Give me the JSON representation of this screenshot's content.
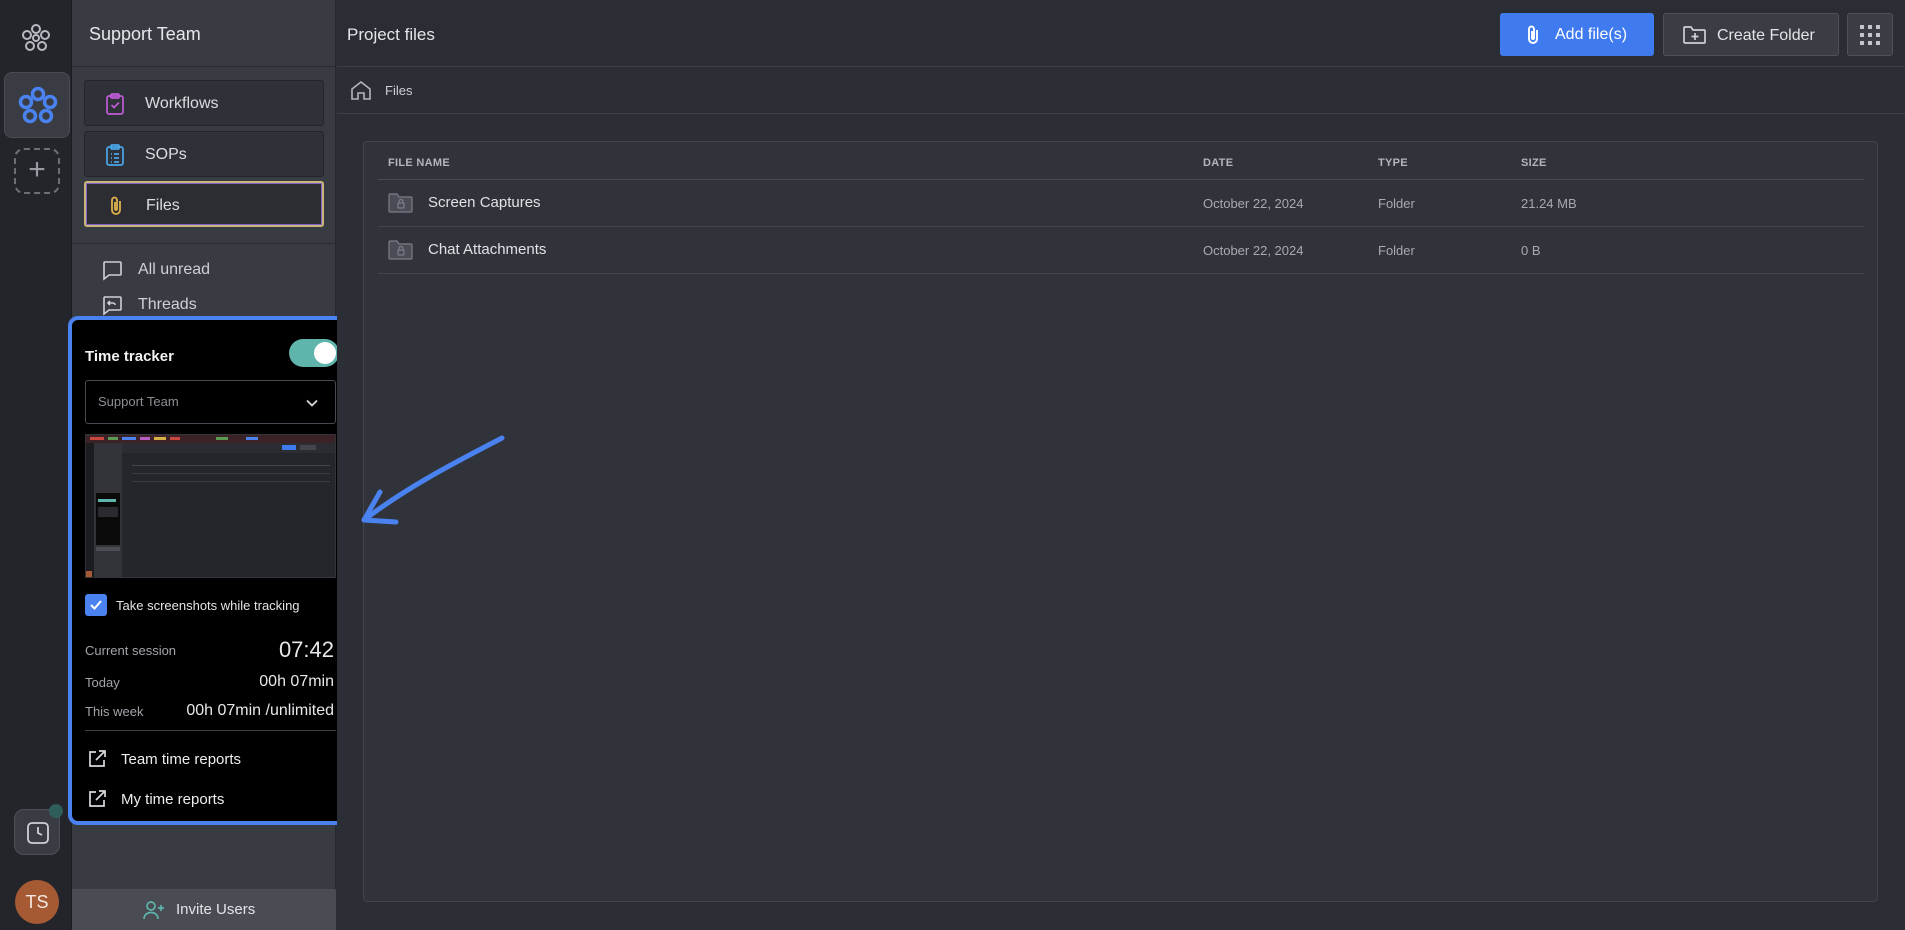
{
  "rail": {
    "avatar_initials": "TS"
  },
  "sidebar": {
    "team_name": "Support Team",
    "nav": [
      {
        "label": "Workflows",
        "icon": "clipboard-check-icon",
        "color": "#c05bd8"
      },
      {
        "label": "SOPs",
        "icon": "list-clipboard-icon",
        "color": "#4aa7e8"
      },
      {
        "label": "Files",
        "icon": "paperclip-icon",
        "color": "#e0b24a",
        "active": true
      }
    ],
    "channels": [
      {
        "label": "All unread",
        "icon": "chat-bubble-icon"
      },
      {
        "label": "Threads",
        "icon": "threads-icon"
      }
    ],
    "invite_label": "Invite Users"
  },
  "tracker": {
    "title": "Time tracker",
    "enabled": true,
    "team_select": "Support Team",
    "screenshot_label": "Take screenshots while tracking",
    "screenshot_checked": true,
    "current_session_label": "Current session",
    "current_session_value": "07:42",
    "today_label": "Today",
    "today_value": "00h 07min",
    "week_label": "This week",
    "week_value": "00h 07min /unlimited",
    "links": [
      "Team time reports",
      "My time reports"
    ]
  },
  "main": {
    "title": "Project files",
    "add_files_label": "Add file(s)",
    "create_folder_label": "Create Folder",
    "breadcrumb": "Files",
    "columns": [
      "FILE NAME",
      "DATE",
      "TYPE",
      "SIZE"
    ],
    "rows": [
      {
        "name": "Screen Captures",
        "date": "October 22, 2024",
        "type": "Folder",
        "size": "21.24 MB"
      },
      {
        "name": "Chat Attachments",
        "date": "October 22, 2024",
        "type": "Folder",
        "size": "0 B"
      }
    ]
  },
  "colors": {
    "accent": "#3f7bef",
    "highlight_border": "#4a82f0",
    "toggle_on": "#5fb4ac"
  }
}
